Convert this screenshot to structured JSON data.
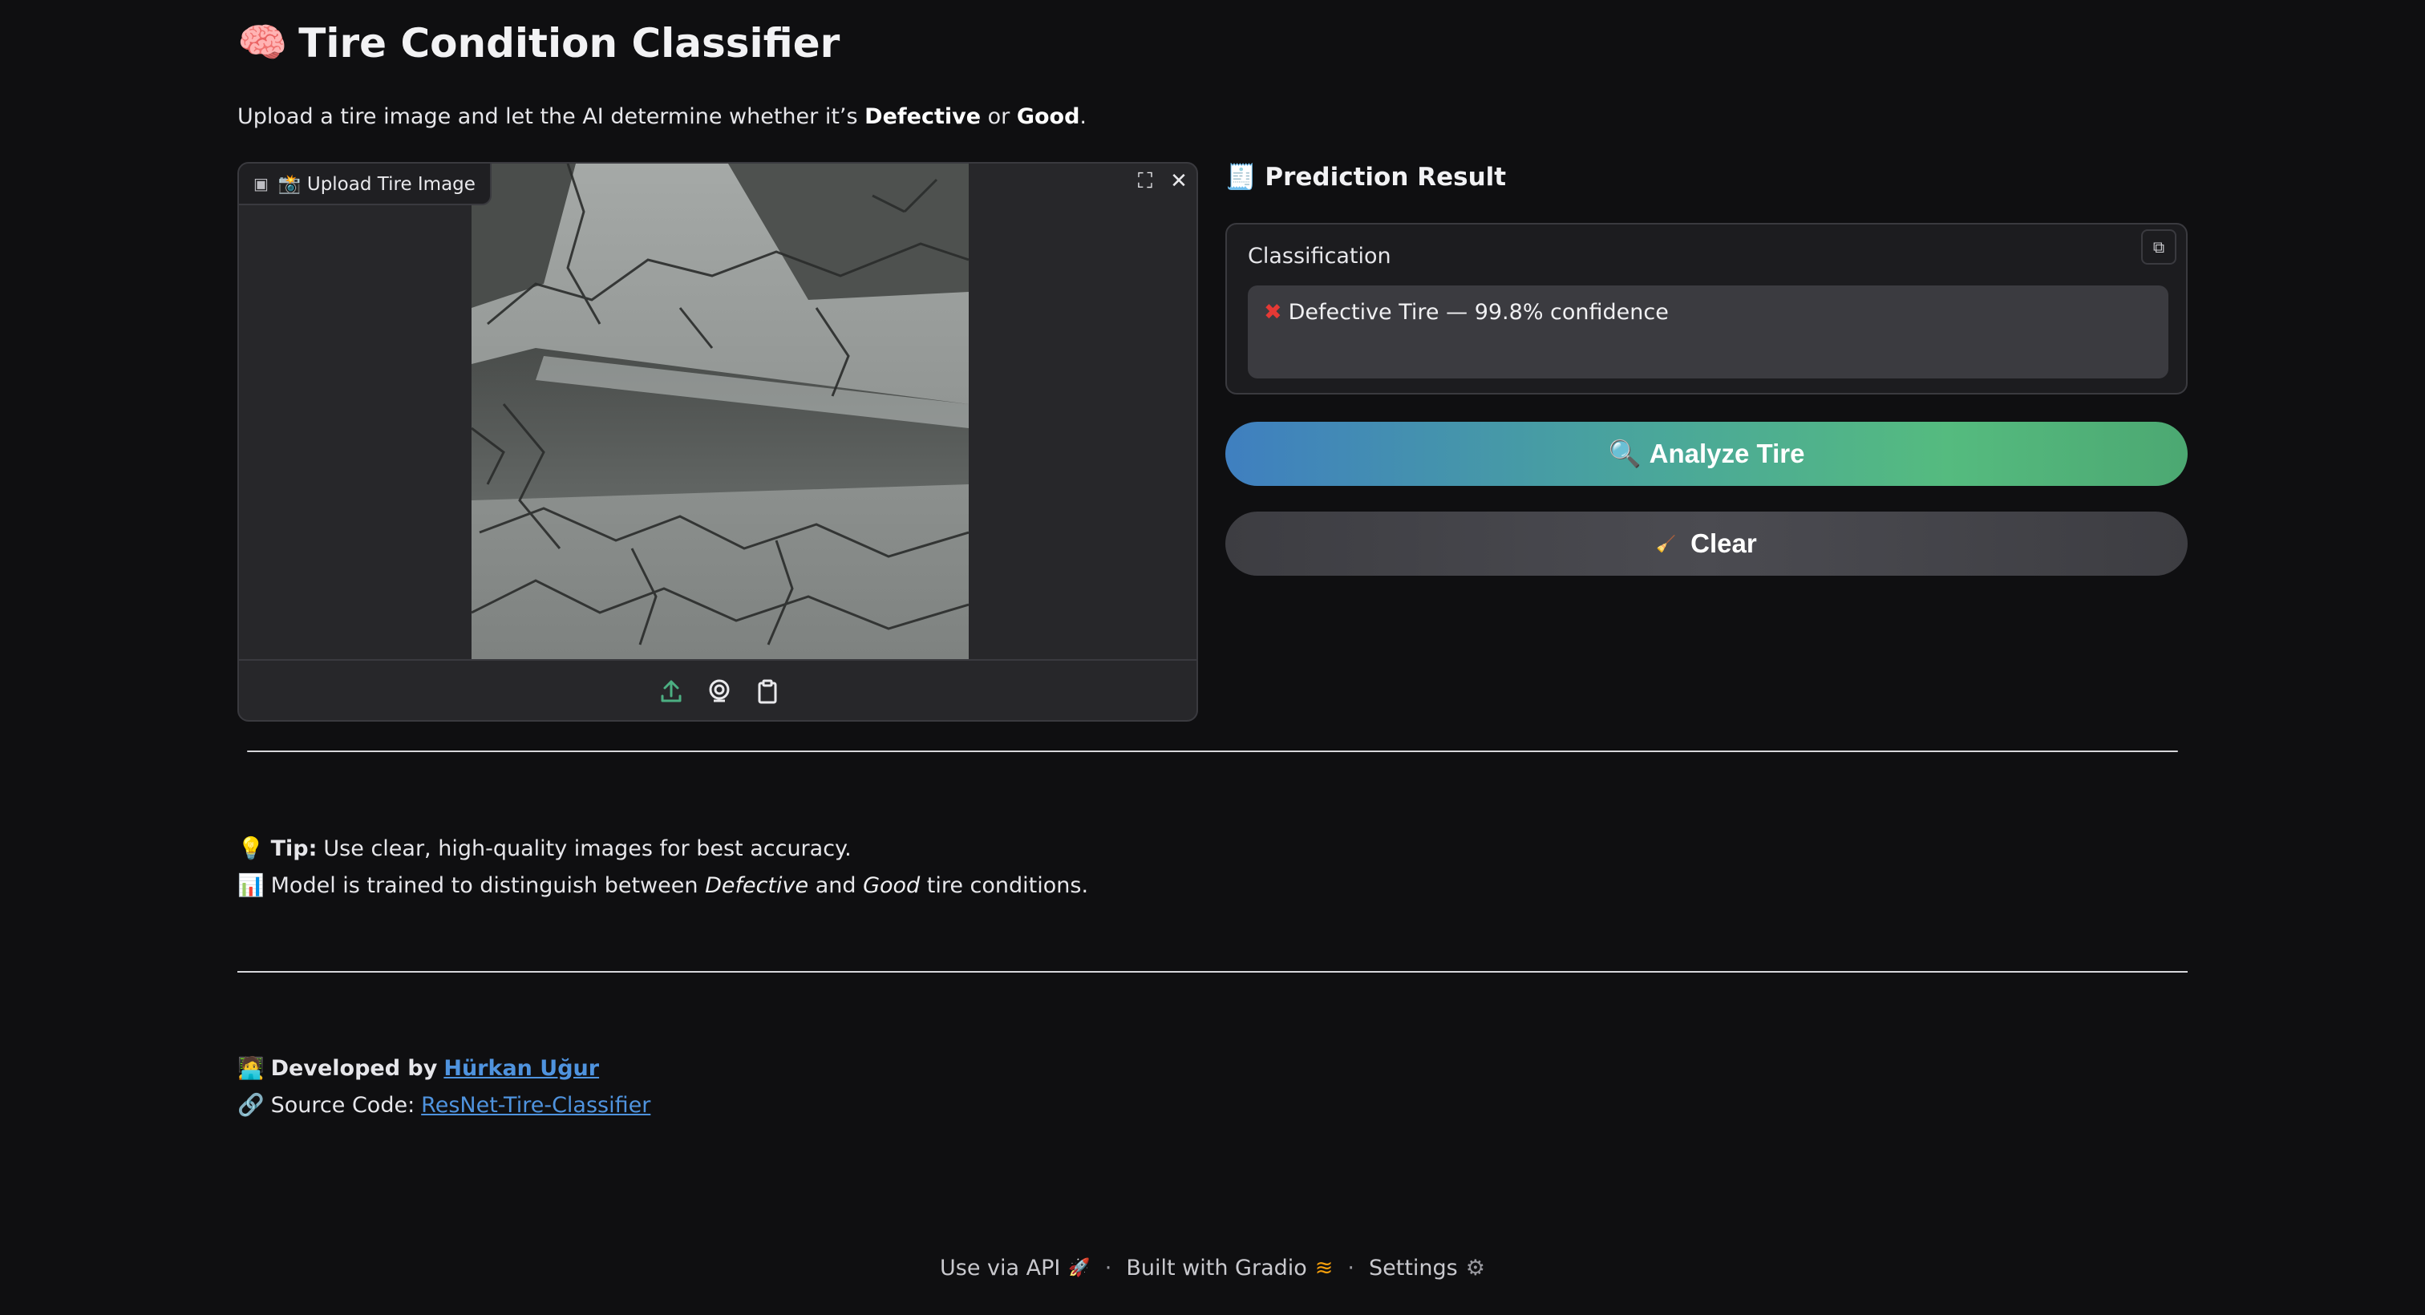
{
  "header": {
    "title": "Tire Condition Classifier",
    "subtitle_pre": "Upload a tire image and let the AI determine whether it’s ",
    "subtitle_defective": "Defective",
    "subtitle_or": " or ",
    "subtitle_good": "Good",
    "subtitle_end": "."
  },
  "upload": {
    "label": "📸 Upload Tire Image",
    "toolbar_icons": [
      "upload-icon",
      "webcam-icon",
      "clipboard-icon"
    ]
  },
  "prediction": {
    "title": "🧾 Prediction Result",
    "label": "Classification",
    "value": "Defective Tire — 99.8% confidence"
  },
  "buttons": {
    "analyze": "Analyze Tire",
    "clear": "Clear"
  },
  "info": {
    "tip_label": "Tip:",
    "tip_text": "Use clear, high-quality images for best accuracy.",
    "model_pre": "Model is trained to distinguish between ",
    "model_defective": "Defective",
    "model_and": " and ",
    "model_good": "Good",
    "model_end": " tire conditions."
  },
  "credits": {
    "developed_by": "Developed by",
    "author": "Hürkan Uğur",
    "source_label": "Source Code:",
    "source_link": "ResNet-Tire-Classifier"
  },
  "footer": {
    "api": "Use via API",
    "built": "Built with Gradio",
    "settings": "Settings",
    "separator": "·"
  },
  "colors": {
    "background": "#0f0f11",
    "analyze_gradient_start": "#3f7fc0",
    "analyze_gradient_end": "#4ca872",
    "link": "#4f93de"
  }
}
